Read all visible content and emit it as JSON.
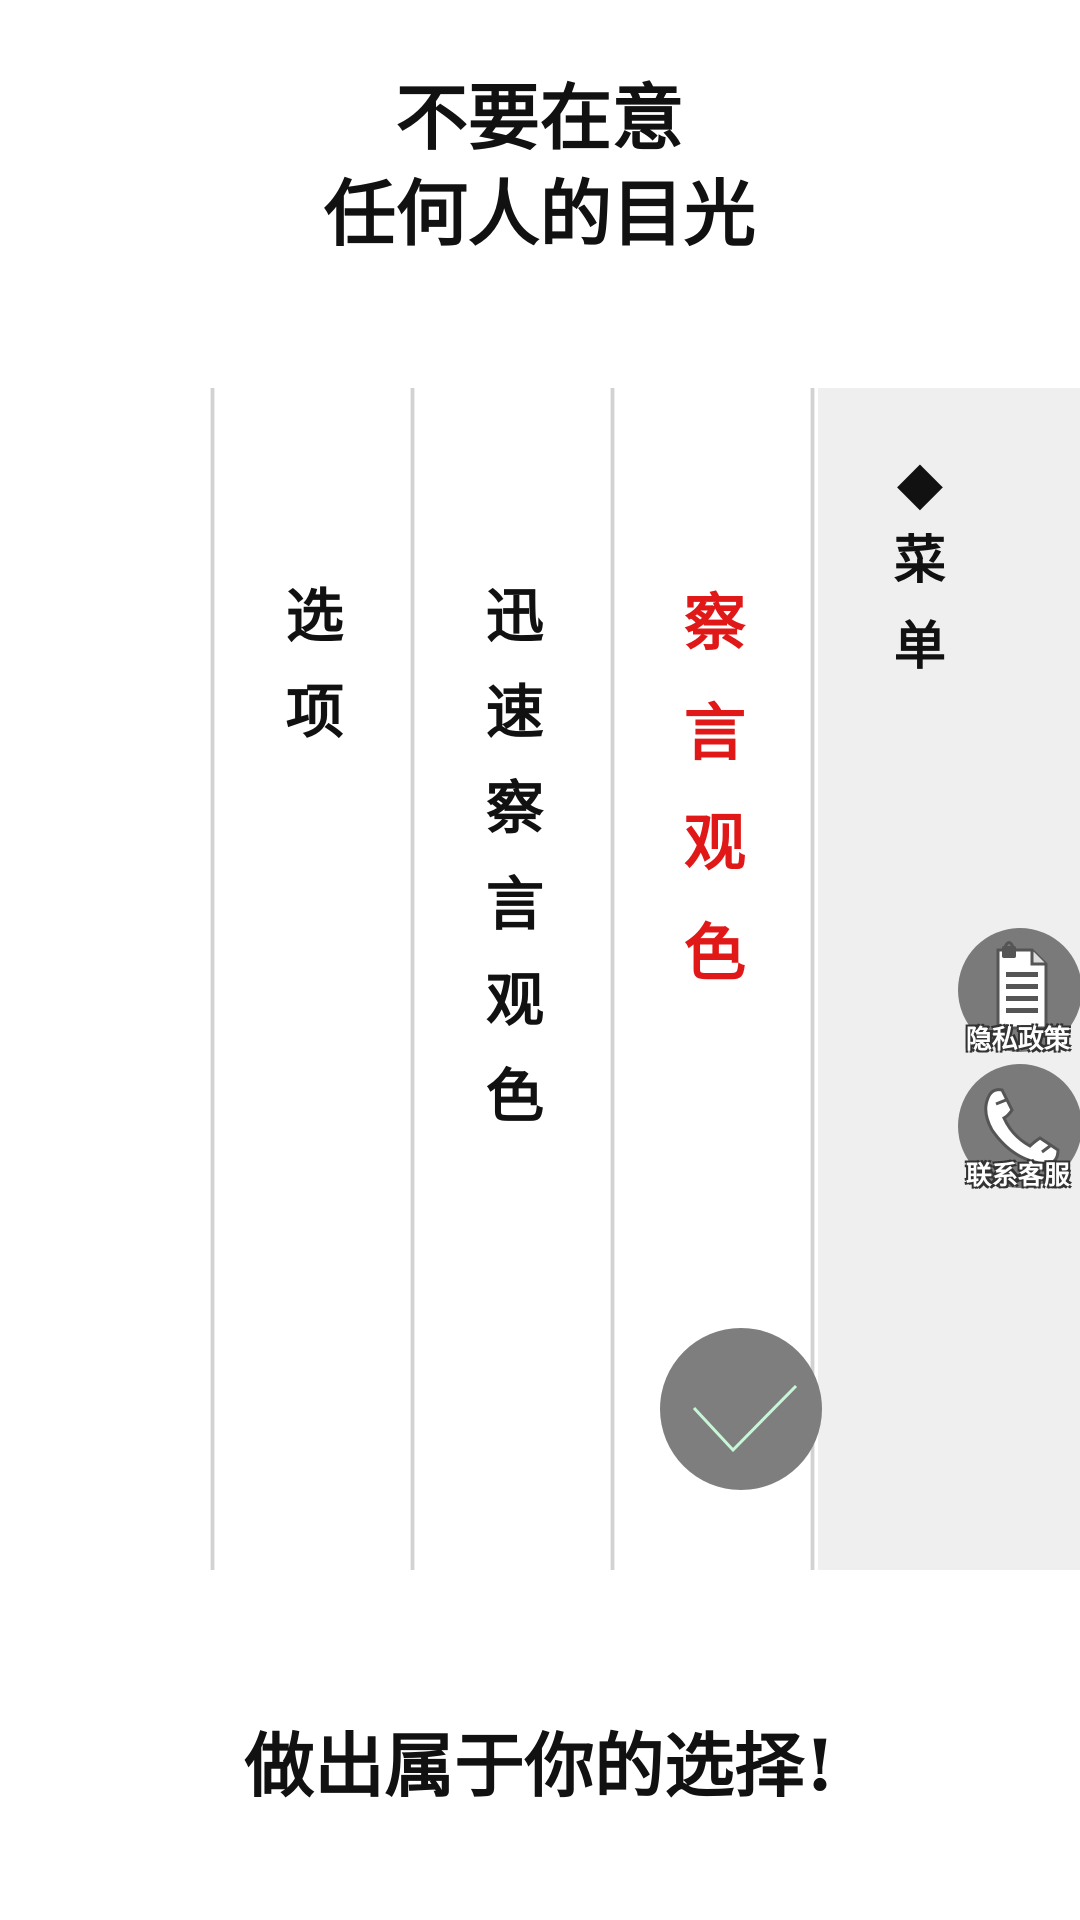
{
  "header": {
    "line1": "不要在意",
    "line2": "任何人的目光"
  },
  "columns": [
    {
      "chars": [
        "选",
        "项"
      ],
      "selected": false
    },
    {
      "chars": [
        "迅",
        "速",
        "察",
        "言",
        "观",
        "色"
      ],
      "selected": false
    },
    {
      "chars": [
        "察",
        "言",
        "观",
        "色"
      ],
      "selected": true
    }
  ],
  "menu": {
    "marker": "◆",
    "title_chars": [
      "菜",
      "单"
    ]
  },
  "side_buttons": {
    "privacy_label": "隐私政策",
    "contact_label": "联系客服"
  },
  "footer": {
    "text": "做出属于你的选择!"
  },
  "colors": {
    "selected_text": "#e01818",
    "menu_bg": "#efefef",
    "button_gray": "#7e7e7e",
    "check_stroke": "#c8f7d8"
  },
  "icons": {
    "privacy": "document-lock-icon",
    "contact": "phone-icon",
    "confirm": "checkmark-icon"
  }
}
